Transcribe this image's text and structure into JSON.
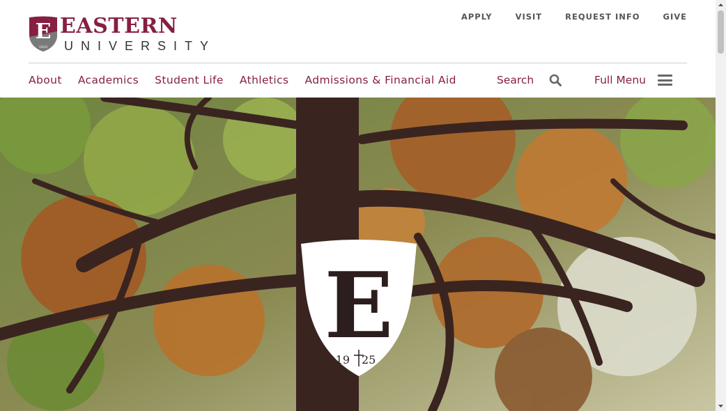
{
  "brand": {
    "name": "EASTERN",
    "subtitle": "UNIVERSITY",
    "founded": "1925",
    "color": "#861f41"
  },
  "utility_nav": [
    "APPLY",
    "VISIT",
    "REQUEST INFO",
    "GIVE"
  ],
  "main_nav": [
    "About",
    "Academics",
    "Student Life",
    "Athletics",
    "Admissions & Financial Aid"
  ],
  "search": {
    "label": "Search",
    "icon": "search-icon"
  },
  "menu": {
    "label": "Full Menu",
    "icon": "hamburger-icon"
  },
  "hero": {
    "emblem_letter": "E",
    "emblem_year_left": "19",
    "emblem_year_right": "25"
  }
}
